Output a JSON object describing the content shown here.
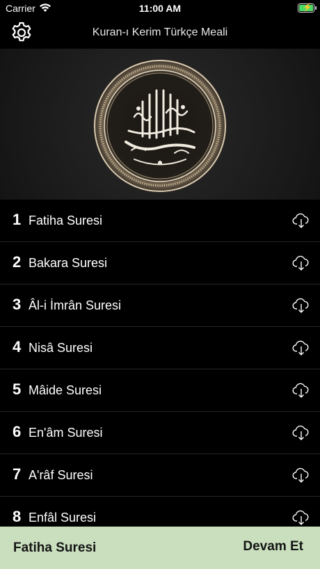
{
  "status_bar": {
    "carrier": "Carrier",
    "time": "11:00 AM",
    "battery_level": 1.0,
    "battery_color": "#4cd964"
  },
  "nav": {
    "title": "Kuran-ı Kerim Türkçe Meali",
    "settings_icon": "gear-icon"
  },
  "header": {
    "image": "bismillah-calligraphy-medallion"
  },
  "suras": [
    {
      "number": "1",
      "name": "Fatiha Suresi"
    },
    {
      "number": "2",
      "name": "Bakara Suresi"
    },
    {
      "number": "3",
      "name": "Âl-i İmrân Suresi"
    },
    {
      "number": "4",
      "name": "Nisâ Suresi"
    },
    {
      "number": "5",
      "name": "Mâide Suresi"
    },
    {
      "number": "6",
      "name": "En'âm Suresi"
    },
    {
      "number": "7",
      "name": "A'râf Suresi"
    },
    {
      "number": "8",
      "name": "Enfâl Suresi"
    }
  ],
  "row_icon": "cloud-download-icon",
  "bottom_bar": {
    "current": "Fatiha Suresi",
    "continue_label": "Devam Et",
    "background": "#c9dfbd"
  }
}
